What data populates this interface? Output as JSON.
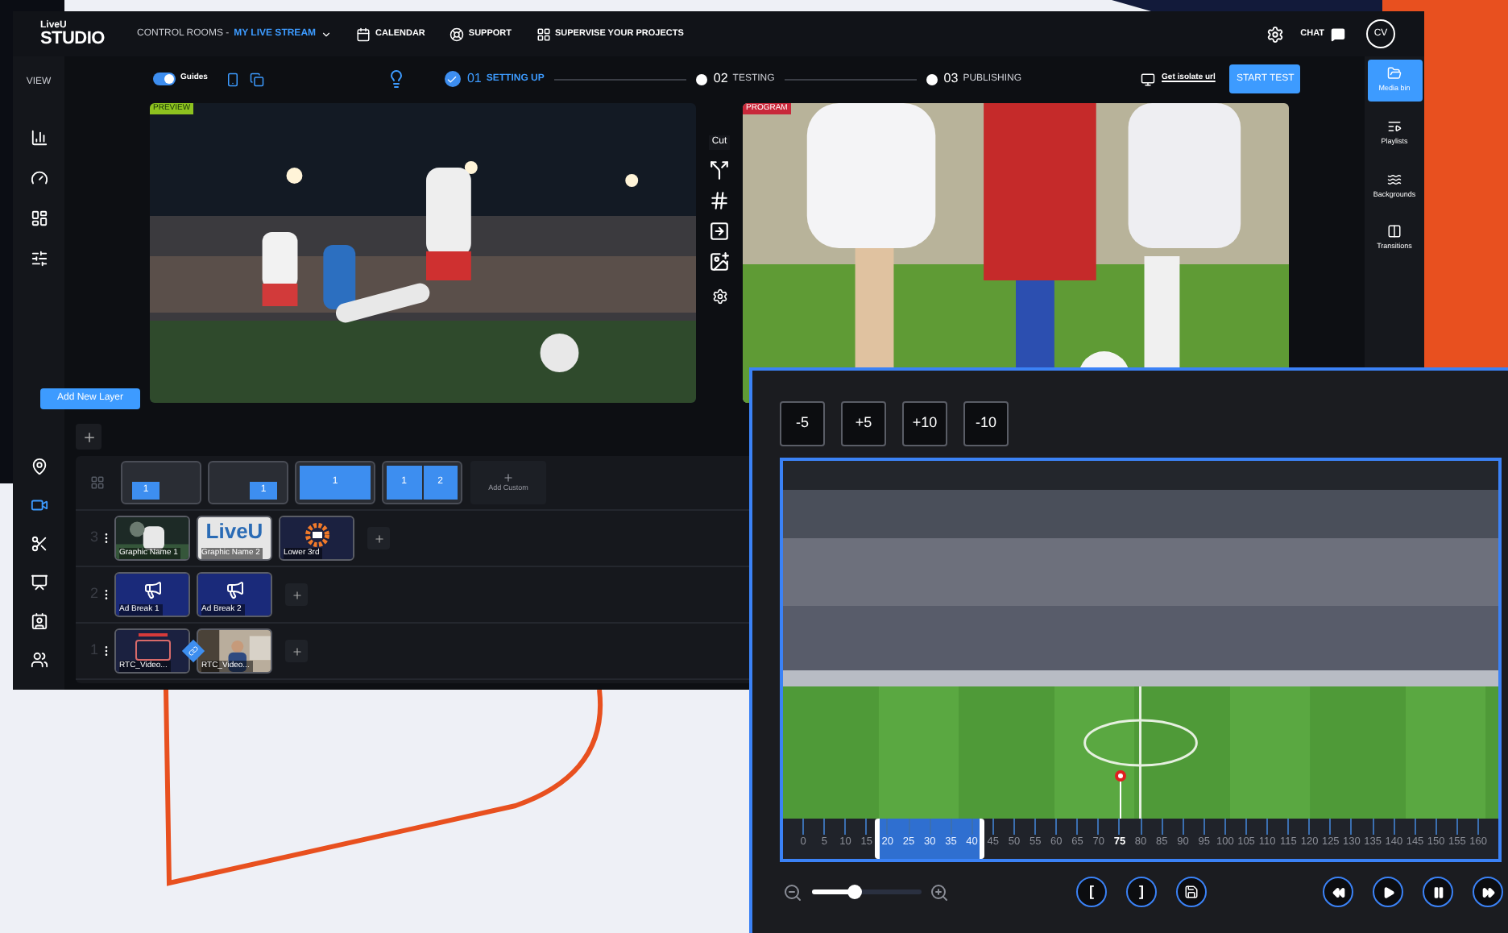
{
  "header": {
    "logo_top": "LiveU",
    "logo_bottom": "STUDIO",
    "room_prefix": "CONTROL ROOMS -",
    "room_name": "MY LIVE STREAM",
    "nav": [
      {
        "label": "CALENDAR"
      },
      {
        "label": "SUPPORT"
      },
      {
        "label": "SUPERVISE YOUR PROJECTS"
      }
    ],
    "chat": "CHAT",
    "avatar": "CV"
  },
  "left_rail": {
    "title": "VIEW",
    "top_items": [
      {
        "selected": false
      },
      {
        "selected": false
      },
      {
        "selected": false
      },
      {
        "selected": false
      }
    ],
    "bottom_items": [
      {
        "selected": false
      },
      {
        "selected": true
      },
      {
        "selected": false
      },
      {
        "selected": false
      },
      {
        "selected": false
      },
      {
        "selected": false
      }
    ]
  },
  "toolbar": {
    "guides": {
      "label": "Guides",
      "on": true
    },
    "steps": [
      {
        "number": "01",
        "label": "SETTING UP",
        "completed": true
      },
      {
        "number": "02",
        "label": "TESTING",
        "completed": false
      },
      {
        "number": "03",
        "label": "PUBLISHING",
        "completed": false
      }
    ],
    "isolate_link": "Get isolate url",
    "start_button": "START TEST"
  },
  "monitors": [
    {
      "kind": "preview",
      "badge": "PREVIEW"
    },
    {
      "kind": "program",
      "badge": "PROGRAM"
    }
  ],
  "cut_tools": {
    "label": "Cut"
  },
  "side_panel": [
    {
      "label": "Media bin",
      "selected": true
    },
    {
      "label": "Playlists",
      "selected": false
    },
    {
      "label": "Backgrounds",
      "selected": false
    },
    {
      "label": "Transitions",
      "selected": false
    }
  ],
  "tooltip": "Add New Layer",
  "layouts": {
    "items": [
      {
        "kind": "left",
        "boxes": [
          "1"
        ]
      },
      {
        "kind": "right",
        "boxes": [
          "1"
        ]
      },
      {
        "kind": "full",
        "boxes": [
          "1"
        ]
      },
      {
        "kind": "split",
        "boxes": [
          "1",
          "2"
        ]
      }
    ],
    "add_custom": "Add Custom"
  },
  "layers": [
    {
      "number": "3",
      "linked": false,
      "sources": [
        {
          "label": "Graphic Name 1"
        },
        {
          "kind": "logo",
          "label": "Graphic Name 2",
          "logo": "LiveU"
        },
        {
          "kind": "badge",
          "label": "Lower 3rd"
        }
      ]
    },
    {
      "number": "2",
      "linked": false,
      "sources": [
        {
          "kind": "promo",
          "label": "Ad Break 1"
        },
        {
          "kind": "promo",
          "label": "Ad Break 2"
        }
      ]
    },
    {
      "number": "1",
      "linked": true,
      "sources": [
        {
          "kind": "frame",
          "label": "RTC_Video..."
        },
        {
          "kind": "person",
          "label": "RTC_Video..."
        }
      ]
    }
  ],
  "clip_editor": {
    "jump_buttons": [
      "-5",
      "+5",
      "+10",
      "-10"
    ],
    "ticks": [
      {
        "label": "0",
        "selected": false,
        "current": false
      },
      {
        "label": "5",
        "selected": false,
        "current": false
      },
      {
        "label": "10",
        "selected": false,
        "current": false
      },
      {
        "label": "15",
        "selected": false,
        "current": false
      },
      {
        "label": "20",
        "selected": true,
        "current": false
      },
      {
        "label": "25",
        "selected": true,
        "current": false
      },
      {
        "label": "30",
        "selected": true,
        "current": false
      },
      {
        "label": "35",
        "selected": true,
        "current": false
      },
      {
        "label": "40",
        "selected": true,
        "current": false
      },
      {
        "label": "45",
        "selected": false,
        "current": false
      },
      {
        "label": "50",
        "selected": false,
        "current": false
      },
      {
        "label": "55",
        "selected": false,
        "current": false
      },
      {
        "label": "60",
        "selected": false,
        "current": false
      },
      {
        "label": "65",
        "selected": false,
        "current": false
      },
      {
        "label": "70",
        "selected": false,
        "current": false
      },
      {
        "label": "75",
        "selected": false,
        "current": true
      },
      {
        "label": "80",
        "selected": false,
        "current": false
      },
      {
        "label": "85",
        "selected": false,
        "current": false
      },
      {
        "label": "90",
        "selected": false,
        "current": false
      },
      {
        "label": "95",
        "selected": false,
        "current": false
      },
      {
        "label": "100",
        "selected": false,
        "current": false
      },
      {
        "label": "105",
        "selected": false,
        "current": false
      },
      {
        "label": "110",
        "selected": false,
        "current": false
      },
      {
        "label": "115",
        "selected": false,
        "current": false
      },
      {
        "label": "120",
        "selected": false,
        "current": false
      },
      {
        "label": "125",
        "selected": false,
        "current": false
      },
      {
        "label": "130",
        "selected": false,
        "current": false
      },
      {
        "label": "135",
        "selected": false,
        "current": false
      },
      {
        "label": "140",
        "selected": false,
        "current": false
      },
      {
        "label": "145",
        "selected": false,
        "current": false
      },
      {
        "label": "150",
        "selected": false,
        "current": false
      },
      {
        "label": "155",
        "selected": false,
        "current": false
      },
      {
        "label": "160",
        "selected": false,
        "current": false
      }
    ],
    "zoom": {
      "level": 0.38
    },
    "marks": [
      "[",
      "]"
    ]
  }
}
